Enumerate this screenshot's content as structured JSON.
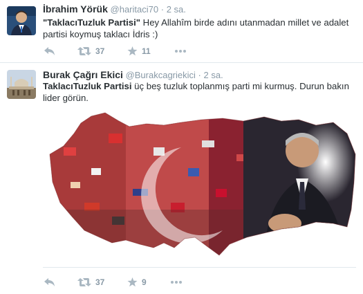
{
  "tweets": [
    {
      "fullname": "İbrahim Yörük",
      "handle": "@haritaci70",
      "separator": "·",
      "time": "2 sa.",
      "text_bold": "\"TaklacıTuzluk Partisi\"",
      "text_rest": "  Hey Allahîm birde adını utanmadan millet ve adalet partisi koymuş taklacı İdris :)",
      "retweets": "37",
      "favorites": "11"
    },
    {
      "fullname": "Burak Çağrı Ekici",
      "handle": "@Burakcagriekici",
      "separator": "·",
      "time": "2 sa.",
      "text_bold": "TaklacıTuzluk Partisi",
      "text_rest": " üç beş tuzluk toplanmış parti mi kurmuş. Durun bakın lider görün.",
      "retweets": "37",
      "favorites": "9"
    }
  ],
  "icons": {
    "reply": "reply-arrow-icon",
    "retweet": "retweet-icon",
    "favorite": "star-icon",
    "more": "more-dots-icon"
  },
  "colors": {
    "name": "#292f33",
    "secondary": "#8899a6",
    "action": "#8899a6",
    "flag_red": "#c8102e"
  }
}
